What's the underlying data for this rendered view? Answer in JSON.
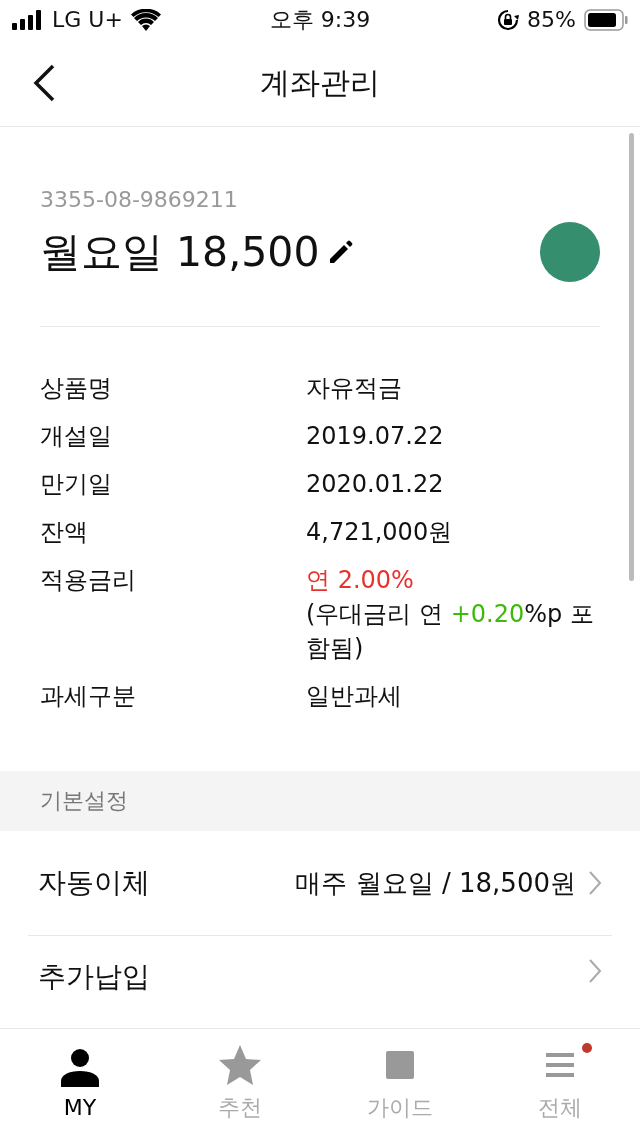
{
  "status_bar": {
    "carrier": "LG U+",
    "time": "오후 9:39",
    "battery": "85%"
  },
  "header": {
    "title": "계좌관리"
  },
  "account": {
    "number": "3355-08-9869211",
    "name": "월요일 18,500"
  },
  "details": [
    {
      "kind": "plain",
      "label": "상품명",
      "value": "자유적금"
    },
    {
      "kind": "plain",
      "label": "개설일",
      "value": "2019.07.22"
    },
    {
      "kind": "plain",
      "label": "만기일",
      "value": "2020.01.22"
    },
    {
      "kind": "plain",
      "label": "잔액",
      "value": "4,721,000원"
    },
    {
      "kind": "rate",
      "label": "적용금리",
      "value": "연 2.00%",
      "note_prefix": "(우대금리 연 ",
      "bonus": "+0.20",
      "note_suffix": "%p 포함됨)"
    },
    {
      "kind": "plain",
      "label": "과세구분",
      "value": "일반과세"
    }
  ],
  "settings": {
    "heading": "기본설정",
    "items": [
      {
        "label": "자동이체",
        "value": "매주 월요일 / 18,500원"
      },
      {
        "label": "추가납입"
      }
    ]
  },
  "tabs": [
    {
      "kind": "person",
      "label": "MY",
      "selected": true,
      "new": false
    },
    {
      "kind": "star",
      "label": "추천",
      "selected": false,
      "new": false
    },
    {
      "kind": "guide",
      "label": "가이드",
      "selected": false,
      "new": false
    },
    {
      "kind": "menu",
      "label": "전체",
      "selected": false,
      "new": true
    }
  ]
}
